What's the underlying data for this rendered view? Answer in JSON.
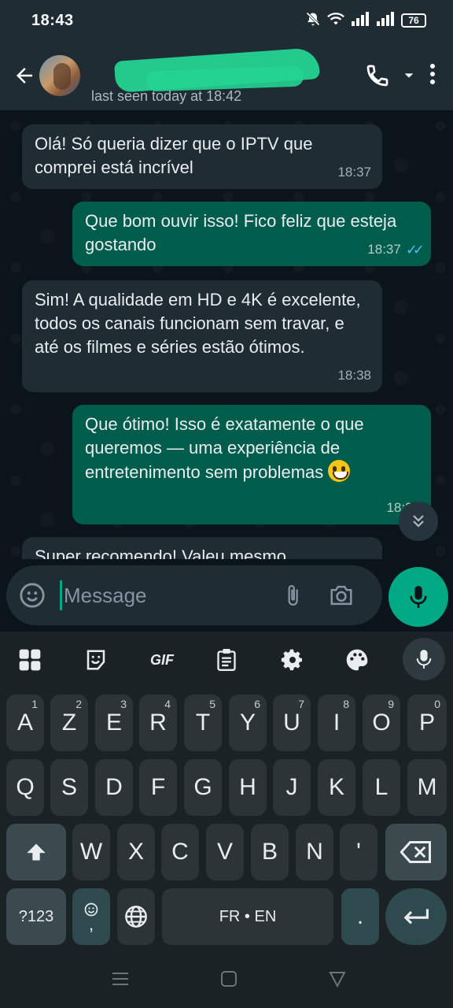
{
  "status_bar": {
    "time": "18:43",
    "battery": "76"
  },
  "header": {
    "contact_status": "last seen today at 18:42"
  },
  "messages": [
    {
      "dir": "in",
      "text": "Olá! Só queria dizer que o IPTV que comprei está incrível",
      "time": "18:37"
    },
    {
      "dir": "out",
      "text": "Que bom ouvir isso! Fico feliz que esteja gostando",
      "time": "18:37"
    },
    {
      "dir": "in",
      "text": "Sim! A qualidade em HD e 4K é excelente, todos os canais funcionam sem travar, e até os filmes e séries estão ótimos.",
      "time": "18:38"
    },
    {
      "dir": "out",
      "text": "Que ótimo! Isso é exatamente o que queremos — uma experiência de entretenimento sem problemas",
      "time": "18:38"
    },
    {
      "dir": "in",
      "text": "Super recomendo! Valeu mesmo"
    }
  ],
  "composer": {
    "placeholder": "Message"
  },
  "keyboard": {
    "toolbar": {
      "gif_label": "GIF"
    },
    "row1": [
      {
        "key": "A",
        "hint": "1"
      },
      {
        "key": "Z",
        "hint": "2"
      },
      {
        "key": "E",
        "hint": "3"
      },
      {
        "key": "R",
        "hint": "4"
      },
      {
        "key": "T",
        "hint": "5"
      },
      {
        "key": "Y",
        "hint": "6"
      },
      {
        "key": "U",
        "hint": "7"
      },
      {
        "key": "I",
        "hint": "8"
      },
      {
        "key": "O",
        "hint": "9"
      },
      {
        "key": "P",
        "hint": "0"
      }
    ],
    "row2": [
      "Q",
      "S",
      "D",
      "F",
      "G",
      "H",
      "J",
      "K",
      "L",
      "M"
    ],
    "row3": [
      "W",
      "X",
      "C",
      "V",
      "B",
      "N",
      "'"
    ],
    "symbols_label": "?123",
    "comma_label": ",",
    "space_label": "FR • EN",
    "period_label": "."
  }
}
